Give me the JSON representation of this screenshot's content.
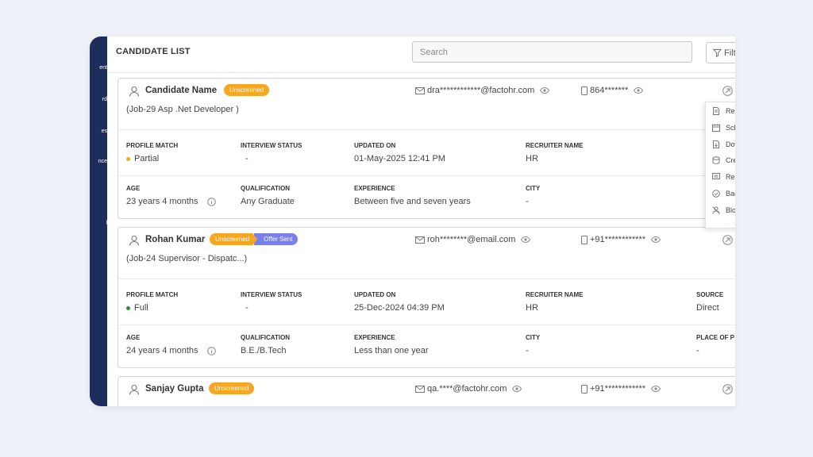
{
  "sidebar": {
    "items": [
      "ent",
      "rd",
      "es",
      "nce",
      "",
      "l"
    ]
  },
  "header": {
    "title": "CANDIDATE LIST",
    "search_placeholder": "Search",
    "filter_label": "Filt"
  },
  "field_labels": {
    "profile_match": "PROFILE MATCH",
    "interview_status": "INTERVIEW STATUS",
    "updated_on": "UPDATED ON",
    "recruiter_name": "RECRUITER NAME",
    "source": "SOURCE",
    "age": "AGE",
    "qualification": "QUALIFICATION",
    "experience": "EXPERIENCE",
    "city": "CITY",
    "place": "PLACE OF P"
  },
  "candidates": [
    {
      "name": "Candidate Name",
      "badges": [
        "Unscreened"
      ],
      "job": "(Job-29 Asp .Net Developer )",
      "email": "dra************@factohr.com",
      "phone": "864*******",
      "profile_match": "Partial",
      "profile_match_color": "#f5a623",
      "interview_status": "-",
      "updated_on": "01-May-2025 12:41 PM",
      "recruiter_name": "HR",
      "age": "23 years 4 months",
      "qualification": "Any Graduate",
      "experience": "Between five and seven years",
      "city": "-"
    },
    {
      "name": "Rohan Kumar",
      "badges": [
        "Unscreened",
        "Offer Sent"
      ],
      "job": "(Job-24 Supervisor - Dispatc...)",
      "email": "roh********@email.com",
      "phone": "+91************",
      "profile_match": "Full",
      "profile_match_color": "#2e8b3d",
      "interview_status": "-",
      "updated_on": "25-Dec-2024 04:39 PM",
      "recruiter_name": "HR",
      "source": "Direct",
      "age": "24 years 4 months",
      "qualification": "B.E./B.Tech",
      "experience": "Less than one year",
      "city": "-",
      "place": "-"
    },
    {
      "name": "Sanjay Gupta",
      "badges": [
        "Unscreened"
      ],
      "email": "qa.****@factohr.com",
      "phone": "+91************"
    }
  ],
  "action_menu": {
    "items": [
      {
        "label": "Resume",
        "icon": "document-icon"
      },
      {
        "label": "Schedu",
        "icon": "calendar-icon"
      },
      {
        "label": "Downlo",
        "icon": "download-icon"
      },
      {
        "label": "Create",
        "icon": "database-icon"
      },
      {
        "label": "Remark",
        "icon": "comment-icon"
      },
      {
        "label": "Backgr",
        "icon": "check-circle-icon"
      },
      {
        "label": "Block C",
        "icon": "block-user-icon"
      }
    ]
  },
  "colors": {
    "sidebar": "#1e2e5c",
    "badge_unscreened": "#f5a623",
    "badge_offer_sent": "#7b7fe8"
  }
}
